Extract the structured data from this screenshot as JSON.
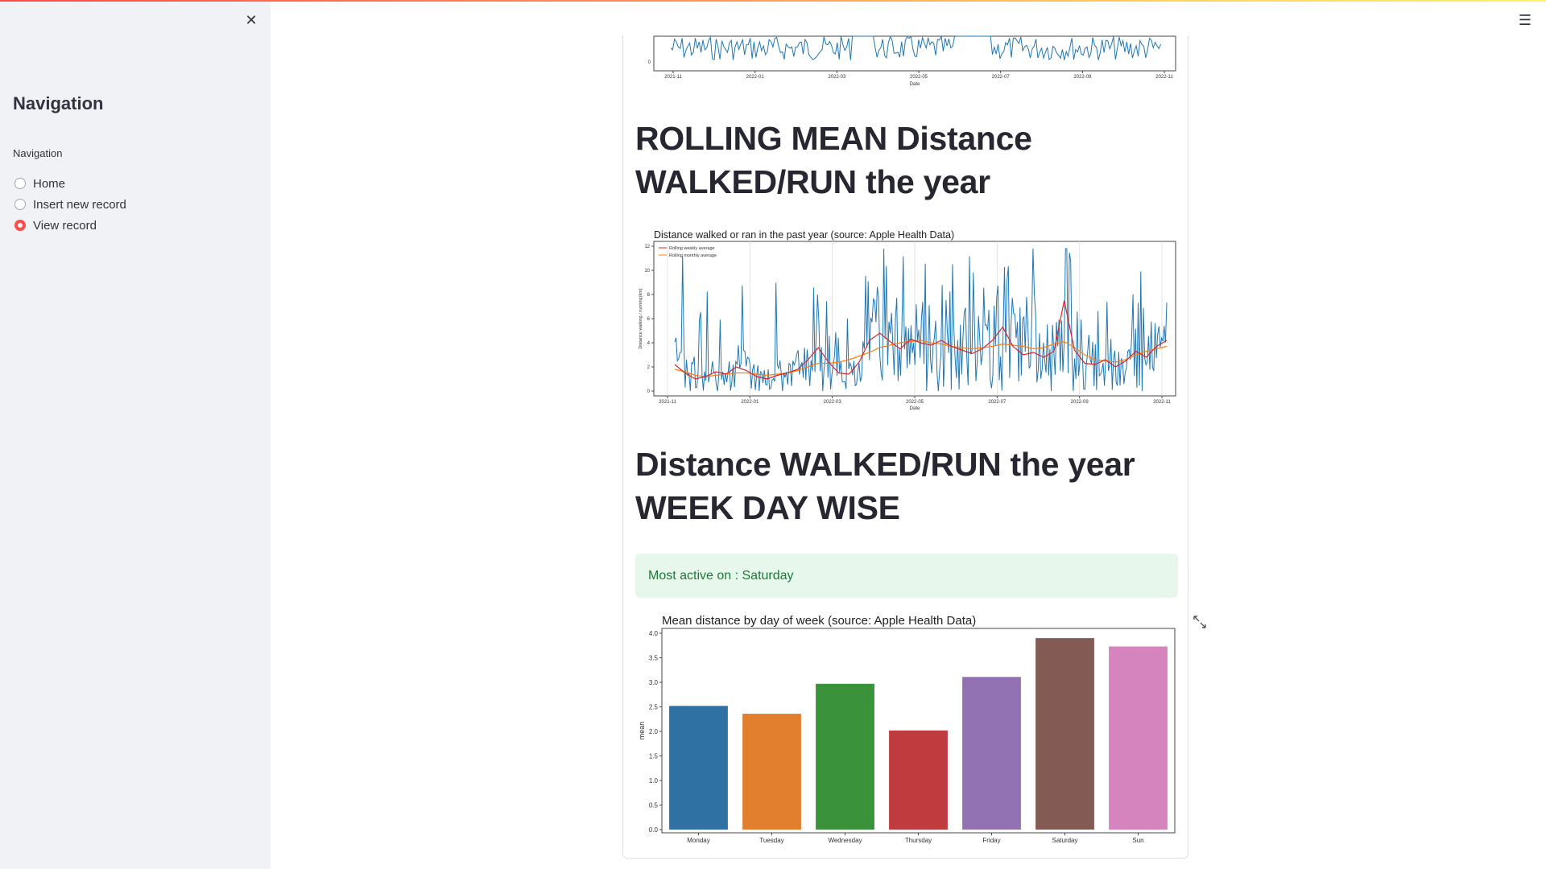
{
  "sidebar": {
    "title": "Navigation",
    "radio_label": "Navigation",
    "options": [
      "Home",
      "Insert new record",
      "View record"
    ],
    "selected_index": 2,
    "close_icon": "close-icon"
  },
  "header": {
    "menu_icon": "hamburger-menu-icon"
  },
  "headings": {
    "rolling_line1": "ROLLING MEAN Distance",
    "rolling_line2": "WALKED/RUN the year",
    "weekday_line1": "Distance WALKED/RUN the year",
    "weekday_line2": "WEEK DAY WISE"
  },
  "success_message": "Most active on : Saturday",
  "colors": {
    "accent": "#ff4b4b",
    "success_bg": "#e8f7ec",
    "success_text": "#1c7a37"
  },
  "chart_data": [
    {
      "type": "line",
      "title": "",
      "xlabel": "Date",
      "ylabel": "",
      "x_ticks": [
        "2021-11",
        "2022-01",
        "2022-03",
        "2022-05",
        "2022-07",
        "2022-09",
        "2022-11"
      ],
      "y_ticks": [
        "0"
      ],
      "note": "partially visible, cropped at top"
    },
    {
      "type": "line",
      "title": "Distance walked or ran in the past year (source: Apple Health Data)",
      "xlabel": "Date",
      "ylabel": "Distance walking / running(km)",
      "ylim": [
        0,
        12
      ],
      "x_ticks": [
        "2021-11",
        "2022-01",
        "2022-03",
        "2022-05",
        "2022-07",
        "2022-09",
        "2022-11"
      ],
      "y_ticks": [
        "0",
        "2",
        "4",
        "6",
        "8",
        "10",
        "12"
      ],
      "legend": [
        "Rolling weekly average",
        "Rolling monthly average"
      ],
      "legend_position": "top-left",
      "series": [
        {
          "name": "Rolling weekly average",
          "color": "#d62728",
          "values": [
            2.2,
            1.5,
            1.0,
            1.2,
            1.6,
            1.4,
            2.0,
            1.7,
            1.2,
            1.0,
            1.3,
            1.5,
            1.8,
            2.6,
            3.6,
            2.4,
            1.5,
            1.4,
            2.4,
            4.2,
            4.8,
            4.1,
            3.5,
            4.3,
            4.0,
            3.8,
            4.2,
            3.7,
            3.4,
            3.1,
            3.5,
            4.2,
            5.3,
            3.7,
            3.0,
            3.2,
            2.8,
            3.3,
            7.5,
            3.4,
            2.3,
            2.2,
            2.6,
            2.0,
            2.5,
            3.3,
            2.8,
            3.7,
            4.2
          ]
        },
        {
          "name": "Rolling monthly average",
          "color": "#ff7f0e",
          "values": [
            1.8,
            1.6,
            1.3,
            1.2,
            1.3,
            1.4,
            1.5,
            1.5,
            1.4,
            1.3,
            1.4,
            1.5,
            1.7,
            2.0,
            2.3,
            2.3,
            2.4,
            2.6,
            2.9,
            3.2,
            3.6,
            3.8,
            4.0,
            4.1,
            4.2,
            4.0,
            3.9,
            3.7,
            3.6,
            3.5,
            3.6,
            3.7,
            3.9,
            3.8,
            3.7,
            3.5,
            3.6,
            3.9,
            4.1,
            3.6,
            3.0,
            2.6,
            2.5,
            2.4,
            2.6,
            3.0,
            3.3,
            3.5,
            3.7
          ]
        }
      ]
    },
    {
      "type": "bar",
      "title": "Mean distance by day of week (source: Apple Health Data)",
      "xlabel": "",
      "ylabel": "mean",
      "ylim": [
        0,
        4.1
      ],
      "y_ticks": [
        "0.0",
        "0.5",
        "1.0",
        "1.5",
        "2.0",
        "2.5",
        "3.0",
        "3.5",
        "4.0"
      ],
      "categories": [
        "Monday",
        "Tuesday",
        "Wednesday",
        "Thursday",
        "Friday",
        "Saturday",
        "Sun"
      ],
      "values": [
        2.52,
        2.36,
        2.97,
        2.02,
        3.11,
        3.9,
        3.73
      ],
      "colors": [
        "#2f71a3",
        "#e17f2e",
        "#3a923a",
        "#c03b3d",
        "#9372b3",
        "#845b54",
        "#d684bd"
      ]
    }
  ]
}
